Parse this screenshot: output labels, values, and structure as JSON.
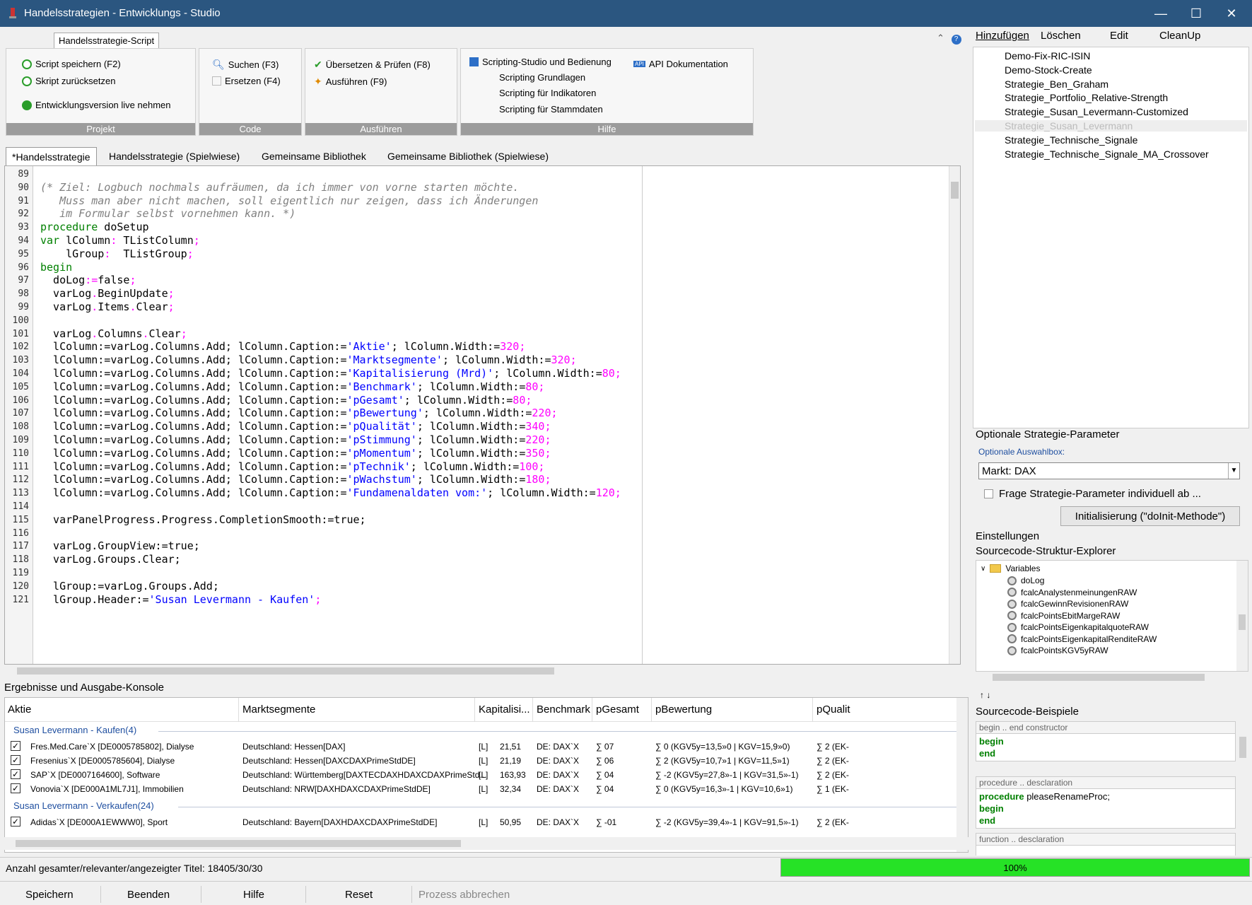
{
  "window": {
    "title": "Handelsstrategien - Entwicklungs - Studio",
    "minimize": "—",
    "maximize": "☐",
    "close": "✕"
  },
  "script_tab": "Handelsstrategie-Script",
  "ribbon": {
    "projekt": {
      "label": "Projekt",
      "save": "Script speichern (F2)",
      "reset": "Skript zurücksetzen",
      "live": "Entwicklungsversion live nehmen"
    },
    "code": {
      "label": "Code",
      "search": "Suchen (F3)",
      "replace": "Ersetzen (F4)"
    },
    "ausfuehren": {
      "label": "Ausführen",
      "compile": "Übersetzen & Prüfen (F8)",
      "run": "Ausführen (F9)"
    },
    "hilfe": {
      "label": "Hilfe",
      "studio": "Scripting-Studio und Bedienung",
      "basics": "Scripting Grundlagen",
      "indicators": "Scripting für Indikatoren",
      "master": "Scripting für Stammdaten",
      "api": "API Dokumentation"
    }
  },
  "doc_tabs": [
    "*Handelsstrategie",
    "Handelsstrategie (Spielwiese)",
    "Gemeinsame Bibliothek",
    "Gemeinsame Bibliothek (Spielwiese)"
  ],
  "editor": {
    "line_numbers": [
      "89",
      "90",
      "91",
      "92",
      "93",
      "94",
      "95",
      "96",
      "97",
      "98",
      "99",
      "100",
      "101",
      "102",
      "103",
      "104",
      "105",
      "106",
      "107",
      "108",
      "109",
      "110",
      "111",
      "112",
      "113",
      "114",
      "115",
      "116",
      "117",
      "118",
      "119",
      "120",
      "121"
    ],
    "lines": [
      [],
      [
        {
          "t": "(* Ziel: Logbuch nochmals aufräumen, da ich immer von vorne starten möchte.",
          "c": "cm"
        }
      ],
      [
        {
          "t": "   Muss man aber nicht machen, soll eigentlich nur zeigen, dass ich Änderungen",
          "c": "cm"
        }
      ],
      [
        {
          "t": "   im Formular selbst vornehmen kann. *)",
          "c": "cm"
        }
      ],
      [
        {
          "t": "procedure",
          "c": "kw"
        },
        {
          "t": " doSetup",
          "c": ""
        }
      ],
      [
        {
          "t": "var",
          "c": "kw"
        },
        {
          "t": " lColumn",
          "c": ""
        },
        {
          "t": ":",
          "c": "op"
        },
        {
          "t": " TListColumn",
          "c": ""
        },
        {
          "t": ";",
          "c": "op"
        }
      ],
      [
        {
          "t": "    lGroup",
          "c": ""
        },
        {
          "t": ":",
          "c": "op"
        },
        {
          "t": "  TListGroup",
          "c": ""
        },
        {
          "t": ";",
          "c": "op"
        }
      ],
      [
        {
          "t": "begin",
          "c": "kw"
        }
      ],
      [
        {
          "t": "  doLog",
          "c": ""
        },
        {
          "t": ":=",
          "c": "op"
        },
        {
          "t": "false",
          "c": ""
        },
        {
          "t": ";",
          "c": "op"
        }
      ],
      [
        {
          "t": "  varLog",
          "c": ""
        },
        {
          "t": ".",
          "c": "op"
        },
        {
          "t": "BeginUpdate",
          "c": ""
        },
        {
          "t": ";",
          "c": "op"
        }
      ],
      [
        {
          "t": "  varLog",
          "c": ""
        },
        {
          "t": ".",
          "c": "op"
        },
        {
          "t": "Items",
          "c": ""
        },
        {
          "t": ".",
          "c": "op"
        },
        {
          "t": "Clear",
          "c": ""
        },
        {
          "t": ";",
          "c": "op"
        }
      ],
      [],
      [
        {
          "t": "  varLog",
          "c": ""
        },
        {
          "t": ".",
          "c": "op"
        },
        {
          "t": "Columns",
          "c": ""
        },
        {
          "t": ".",
          "c": "op"
        },
        {
          "t": "Clear",
          "c": ""
        },
        {
          "t": ";",
          "c": "op"
        }
      ],
      [
        {
          "t": "  lColumn:=varLog.Columns.Add; lColumn.Caption:=",
          "c": ""
        },
        {
          "t": "'Aktie'",
          "c": "st"
        },
        {
          "t": "; lColumn.Width:=",
          "c": ""
        },
        {
          "t": "320",
          "c": "nm"
        },
        {
          "t": ";",
          "c": "op"
        }
      ],
      [
        {
          "t": "  lColumn:=varLog.Columns.Add; lColumn.Caption:=",
          "c": ""
        },
        {
          "t": "'Marktsegmente'",
          "c": "st"
        },
        {
          "t": "; lColumn.Width:=",
          "c": ""
        },
        {
          "t": "320",
          "c": "nm"
        },
        {
          "t": ";",
          "c": "op"
        }
      ],
      [
        {
          "t": "  lColumn:=varLog.Columns.Add; lColumn.Caption:=",
          "c": ""
        },
        {
          "t": "'Kapitalisierung (Mrd)'",
          "c": "st"
        },
        {
          "t": "; lColumn.Width:=",
          "c": ""
        },
        {
          "t": "80",
          "c": "nm"
        },
        {
          "t": ";",
          "c": "op"
        }
      ],
      [
        {
          "t": "  lColumn:=varLog.Columns.Add; lColumn.Caption:=",
          "c": ""
        },
        {
          "t": "'Benchmark'",
          "c": "st"
        },
        {
          "t": "; lColumn.Width:=",
          "c": ""
        },
        {
          "t": "80",
          "c": "nm"
        },
        {
          "t": ";",
          "c": "op"
        }
      ],
      [
        {
          "t": "  lColumn:=varLog.Columns.Add; lColumn.Caption:=",
          "c": ""
        },
        {
          "t": "'pGesamt'",
          "c": "st"
        },
        {
          "t": "; lColumn.Width:=",
          "c": ""
        },
        {
          "t": "80",
          "c": "nm"
        },
        {
          "t": ";",
          "c": "op"
        }
      ],
      [
        {
          "t": "  lColumn:=varLog.Columns.Add; lColumn.Caption:=",
          "c": ""
        },
        {
          "t": "'pBewertung'",
          "c": "st"
        },
        {
          "t": "; lColumn.Width:=",
          "c": ""
        },
        {
          "t": "220",
          "c": "nm"
        },
        {
          "t": ";",
          "c": "op"
        }
      ],
      [
        {
          "t": "  lColumn:=varLog.Columns.Add; lColumn.Caption:=",
          "c": ""
        },
        {
          "t": "'pQualität'",
          "c": "st"
        },
        {
          "t": "; lColumn.Width:=",
          "c": ""
        },
        {
          "t": "340",
          "c": "nm"
        },
        {
          "t": ";",
          "c": "op"
        }
      ],
      [
        {
          "t": "  lColumn:=varLog.Columns.Add; lColumn.Caption:=",
          "c": ""
        },
        {
          "t": "'pStimmung'",
          "c": "st"
        },
        {
          "t": "; lColumn.Width:=",
          "c": ""
        },
        {
          "t": "220",
          "c": "nm"
        },
        {
          "t": ";",
          "c": "op"
        }
      ],
      [
        {
          "t": "  lColumn:=varLog.Columns.Add; lColumn.Caption:=",
          "c": ""
        },
        {
          "t": "'pMomentum'",
          "c": "st"
        },
        {
          "t": "; lColumn.Width:=",
          "c": ""
        },
        {
          "t": "350",
          "c": "nm"
        },
        {
          "t": ";",
          "c": "op"
        }
      ],
      [
        {
          "t": "  lColumn:=varLog.Columns.Add; lColumn.Caption:=",
          "c": ""
        },
        {
          "t": "'pTechnik'",
          "c": "st"
        },
        {
          "t": "; lColumn.Width:=",
          "c": ""
        },
        {
          "t": "100",
          "c": "nm"
        },
        {
          "t": ";",
          "c": "op"
        }
      ],
      [
        {
          "t": "  lColumn:=varLog.Columns.Add; lColumn.Caption:=",
          "c": ""
        },
        {
          "t": "'pWachstum'",
          "c": "st"
        },
        {
          "t": "; lColumn.Width:=",
          "c": ""
        },
        {
          "t": "180",
          "c": "nm"
        },
        {
          "t": ";",
          "c": "op"
        }
      ],
      [
        {
          "t": "  lColumn:=varLog.Columns.Add; lColumn.Caption:=",
          "c": ""
        },
        {
          "t": "'Fundamenaldaten vom:'",
          "c": "st"
        },
        {
          "t": "; lColumn.Width:=",
          "c": ""
        },
        {
          "t": "120",
          "c": "nm"
        },
        {
          "t": ";",
          "c": "op"
        }
      ],
      [],
      [
        {
          "t": "  varPanelProgress.Progress.CompletionSmooth:=true;",
          "c": ""
        }
      ],
      [],
      [
        {
          "t": "  varLog.GroupView:=true;",
          "c": ""
        }
      ],
      [
        {
          "t": "  varLog.Groups.Clear;",
          "c": ""
        }
      ],
      [],
      [
        {
          "t": "  lGroup:=varLog.Groups.Add;",
          "c": ""
        }
      ],
      [
        {
          "t": "  lGroup.Header:=",
          "c": ""
        },
        {
          "t": "'Susan Levermann - Kaufen'",
          "c": "st"
        },
        {
          "t": ";",
          "c": "op"
        }
      ]
    ]
  },
  "results": {
    "title": "Ergebnisse und Ausgabe-Konsole",
    "columns": [
      "Aktie",
      "Marktsegmente",
      "Kapitalisi...",
      "Benchmark",
      "pGesamt",
      "pBewertung",
      "pQualit"
    ],
    "groups": [
      {
        "header": "Susan Levermann - Kaufen(4)",
        "rows": [
          [
            "Fres.Med.Care`X [DE0005785802], Dialyse",
            "Deutschland: Hessen[DAX]",
            "[L]",
            "21,51",
            "DE: DAX`X",
            "∑ 07",
            "∑ 0 (KGV5y=13,5»0 | KGV=15,9»0)",
            "∑ 2 (EK-"
          ],
          [
            "Fresenius`X [DE0005785604], Dialyse",
            "Deutschland: Hessen[DAXCDAXPrimeStdDE]",
            "[L]",
            "21,19",
            "DE: DAX`X",
            "∑ 06",
            "∑ 2 (KGV5y=10,7»1 | KGV=11,5»1)",
            "∑ 2 (EK-"
          ],
          [
            "SAP`X [DE0007164600], Software",
            "Deutschland: Württemberg[DAXTECDAXHDAXCDAXPrimeStd...",
            "[L]",
            "163,93",
            "DE: DAX`X",
            "∑ 04",
            "∑ -2 (KGV5y=27,8»-1 | KGV=31,5»-1)",
            "∑ 2 (EK-"
          ],
          [
            "Vonovia`X [DE000A1ML7J1], Immobilien",
            "Deutschland: NRW[DAXHDAXCDAXPrimeStdDE]",
            "[L]",
            "32,34",
            "DE: DAX`X",
            "∑ 04",
            "∑ 0 (KGV5y=16,3»-1 | KGV=10,6»1)",
            "∑ 1 (EK-"
          ]
        ]
      },
      {
        "header": "Susan Levermann - Verkaufen(24)",
        "rows": [
          [
            "Adidas`X [DE000A1EWWW0], Sport",
            "Deutschland: Bayern[DAXHDAXCDAXPrimeStdDE]",
            "[L]",
            "50,95",
            "DE: DAX`X",
            "∑ -01",
            "∑ -2 (KGV5y=39,4»-1 | KGV=91,5»-1)",
            "∑ 2 (EK-"
          ]
        ]
      }
    ]
  },
  "status": {
    "text": "Anzahl gesamter/relevanter/angezeigter Titel:  18405/30/30",
    "progress_label": "100%",
    "progress": 1.0
  },
  "bottom_buttons": [
    "Speichern",
    "Beenden",
    "Hilfe",
    "Reset",
    "Prozess abbrechen"
  ],
  "right": {
    "menu": [
      "Hinzufügen",
      "Löschen",
      "Edit",
      "CleanUp"
    ],
    "strategies": [
      "Demo-Fix-RIC-ISIN",
      "Demo-Stock-Create",
      "Strategie_Ben_Graham",
      "Strategie_Portfolio_Relative-Strength",
      "Strategie_Susan_Levermann-Customized",
      "Strategie_Susan_Levermann",
      "Strategie_Technische_Signale",
      "Strategie_Technische_Signale_MA_Crossover"
    ],
    "selected_index": 5,
    "params_title": "Optionale Strategie-Parameter",
    "opt_label": "Optionale Auswahlbox:",
    "combo_value": "Markt: DAX",
    "checkbox_label": "Frage Strategie-Parameter individuell ab ...",
    "init_button": "Initialisierung (\"doInit-Methode\")",
    "settings": "Einstellungen",
    "explorer_title": "Sourcecode-Struktur-Explorer",
    "tree_root": "Variables",
    "tree_items": [
      "doLog",
      "fcalcAnalystenmeinungenRAW",
      "fcalcGewinnRevisionenRAW",
      "fcalcPointsEbitMargeRAW",
      "fcalcPointsEigenkapitalquoteRAW",
      "fcalcPointsEigenkapitalRenditeRAW",
      "fcalcPointsKGV5yRAW"
    ],
    "samples_title": "Sourcecode-Beispiele",
    "samples": [
      {
        "header": "begin .. end constructor",
        "lines": [
          {
            "kw": "begin",
            "rest": ""
          },
          {
            "kw": "end",
            "rest": ""
          }
        ]
      },
      {
        "header": "procedure .. desclaration",
        "lines": [
          {
            "kw": "procedure",
            "rest": " pleaseRenameProc;"
          },
          {
            "kw": "begin",
            "rest": ""
          },
          {
            "kw": "end",
            "rest": ""
          }
        ]
      },
      {
        "header": "function .. desclaration",
        "lines": []
      }
    ]
  },
  "colors": {
    "comment": "#808080",
    "keyword": "#008000",
    "string": "#0000ff",
    "number": "#ff00ff",
    "titlebar": "#2b5680",
    "progress": "#26e226"
  }
}
